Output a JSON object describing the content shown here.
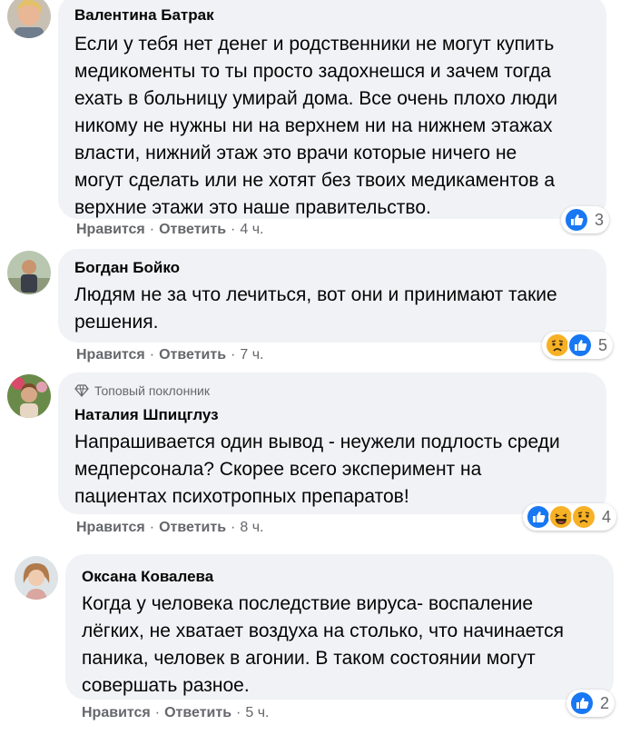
{
  "comments": [
    {
      "author": "Валентина Батрак",
      "badge": "",
      "text": "Если у тебя нет денег и родственники не могут купить\nмедикоменты то ты просто задохнешся и зачем тогда\nехать в больницу умирай дома. Все очень плохо люди\nникому не нужны ни на верхнем ни на нижнем этажах\nвласти, нижний этаж это врачи которые ничего не\nмогут сделать или не хотят без твоих медикаментов а\nверхние этажи это наше правительство.",
      "like": "Нравится",
      "reply": "Ответить",
      "time": "4 ч.",
      "reactions": [
        "like"
      ],
      "reaction_count": "3"
    },
    {
      "author": "Богдан Бойко",
      "badge": "",
      "text": "Людям не за что лечиться, вот они и принимают такие\nрешения.",
      "like": "Нравится",
      "reply": "Ответить",
      "time": "7 ч.",
      "reactions": [
        "sad",
        "like"
      ],
      "reaction_count": "5"
    },
    {
      "author": "Наталия Шпицглуз",
      "badge": "Топовый поклонник",
      "text": "Напрашивается один вывод - неужели подлость среди\nмедперсонала? Скорее всего эксперимент на\nпациентах психотропных препаратов!",
      "like": "Нравится",
      "reply": "Ответить",
      "time": "8 ч.",
      "reactions": [
        "like",
        "haha",
        "sad"
      ],
      "reaction_count": "4"
    },
    {
      "author": "Оксана Ковалева",
      "badge": "",
      "text": "Когда у человека последствие вируса- воспаление\nлёгких, не хватает воздуха на столько, что начинается\nпаника, человек в агонии. В таком состоянии могут\nсовершать разное.",
      "like": "Нравится",
      "reply": "Ответить",
      "time": "5 ч.",
      "reactions": [
        "like"
      ],
      "reaction_count": "2"
    }
  ],
  "dot": "·",
  "colors": {
    "bubble": "#f0f2f5",
    "meta": "#65676b",
    "like_blue": "#1877f2",
    "emoji_yellow": "#f7b125"
  }
}
